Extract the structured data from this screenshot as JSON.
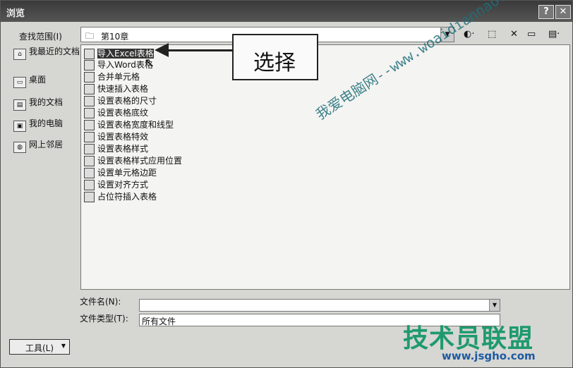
{
  "window": {
    "title": "浏览",
    "help_btn": "?",
    "close_btn": "✕"
  },
  "lookin": {
    "label": "查找范围(I)",
    "value": "第10章"
  },
  "places": [
    {
      "label": "我最近的文档"
    },
    {
      "label": "桌面"
    },
    {
      "label": "我的文档"
    },
    {
      "label": "我的电脑"
    },
    {
      "label": "网上邻居"
    }
  ],
  "files": [
    {
      "label": "导入Excel表格"
    },
    {
      "label": "导入Word表格"
    },
    {
      "label": "合并单元格"
    },
    {
      "label": "快速插入表格"
    },
    {
      "label": "设置表格的尺寸"
    },
    {
      "label": "设置表格底纹"
    },
    {
      "label": "设置表格宽度和线型"
    },
    {
      "label": "设置表格特效"
    },
    {
      "label": "设置表格样式"
    },
    {
      "label": "设置表格样式应用位置"
    },
    {
      "label": "设置单元格边距"
    },
    {
      "label": "设置对齐方式"
    },
    {
      "label": "占位符插入表格"
    }
  ],
  "callout": {
    "text": "选择"
  },
  "filename": {
    "label": "文件名(N):",
    "value": ""
  },
  "filetype": {
    "label": "文件类型(T):",
    "value": "所有文件"
  },
  "tools": {
    "label": "工具(L)"
  },
  "watermarks": {
    "url": "我爱电脑网--www.woaidiannao.com",
    "brand": "技术员联盟",
    "site": "www.jsgho.com"
  },
  "icons": [
    "folder-icon",
    "back-icon",
    "up-folder-icon",
    "delete-icon",
    "new-folder-icon",
    "views-icon",
    "dropdown-icon"
  ]
}
